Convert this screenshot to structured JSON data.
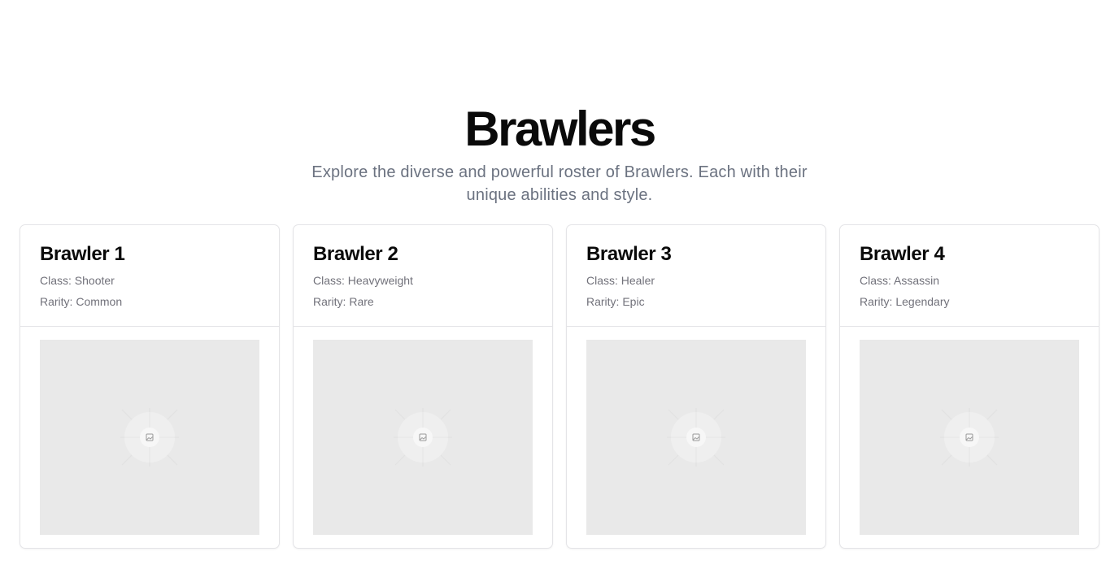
{
  "hero": {
    "title": "Brawlers",
    "subtitle": "Explore the diverse and powerful roster of Brawlers. Each with their unique abilities and style."
  },
  "brawlers": [
    {
      "name": "Brawler 1",
      "class_text": "Class: Shooter",
      "rarity_text": "Rarity: Common",
      "image_icon": "image-placeholder-icon"
    },
    {
      "name": "Brawler 2",
      "class_text": "Class: Heavyweight",
      "rarity_text": "Rarity: Rare",
      "image_icon": "image-placeholder-icon"
    },
    {
      "name": "Brawler 3",
      "class_text": "Class: Healer",
      "rarity_text": "Rarity: Epic",
      "image_icon": "image-placeholder-icon"
    },
    {
      "name": "Brawler 4",
      "class_text": "Class: Assassin",
      "rarity_text": "Rarity: Legendary",
      "image_icon": "image-placeholder-icon"
    }
  ],
  "colors": {
    "placeholder_bg": "#e9e9e9",
    "muted_text": "#6b7280",
    "border": "#e4e4e7"
  }
}
